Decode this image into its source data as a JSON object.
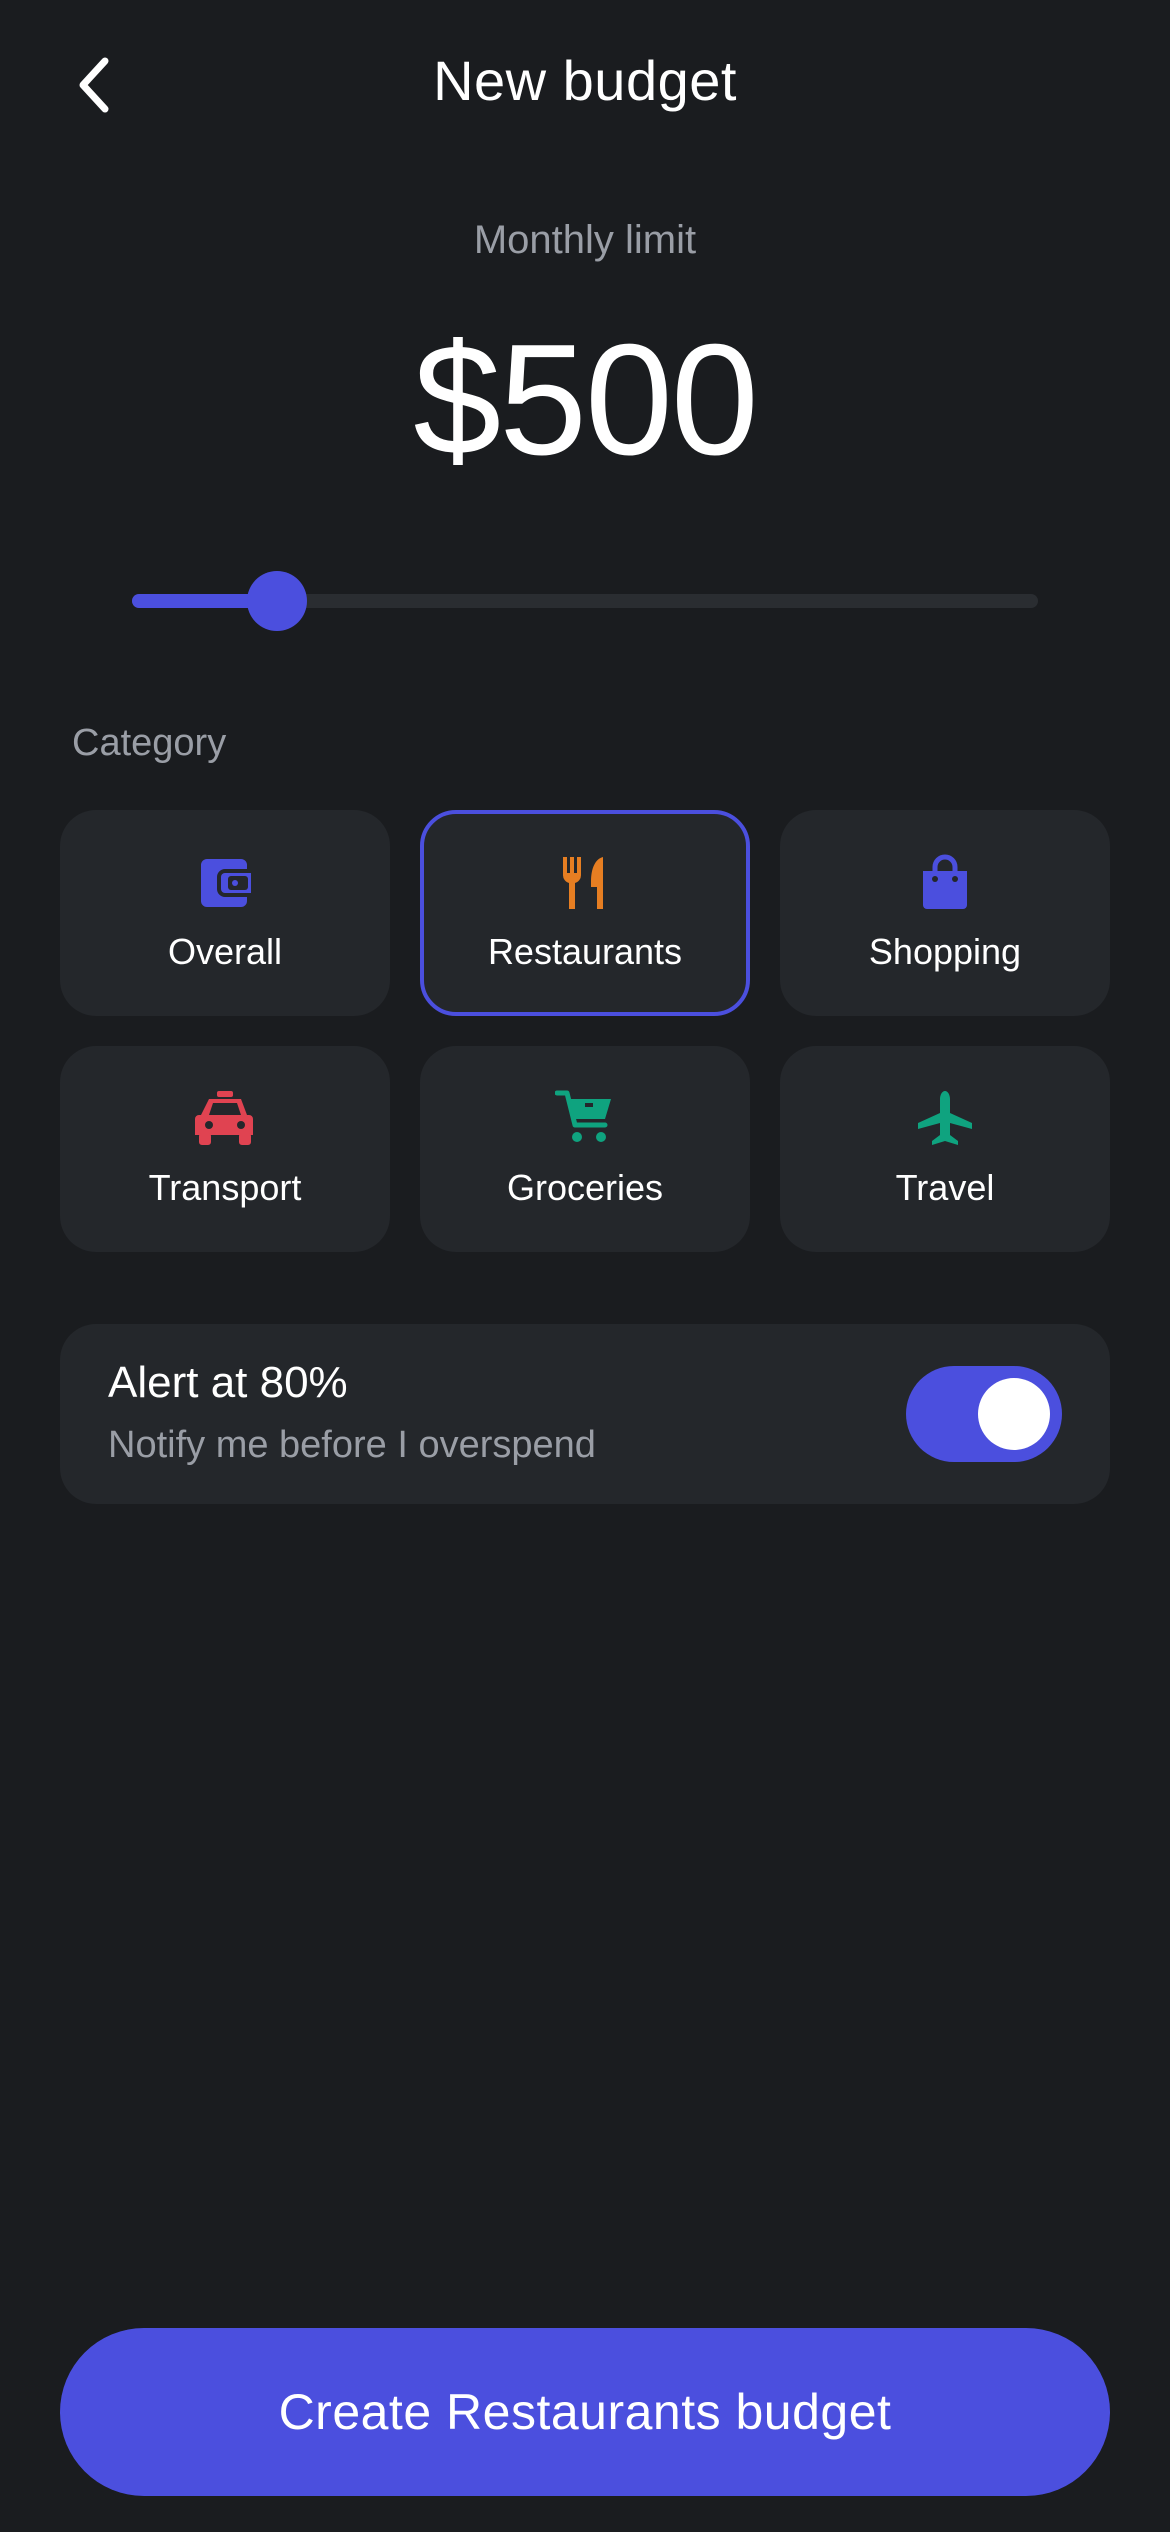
{
  "header": {
    "title": "New budget",
    "back_icon": "chevron-left-icon"
  },
  "limit": {
    "label": "Monthly limit",
    "amount": "$500",
    "slider_fraction": 0.16
  },
  "category": {
    "label": "Category",
    "selected": "Restaurants",
    "items": [
      {
        "label": "Overall",
        "icon": "wallet-icon",
        "color": "#4b4fde"
      },
      {
        "label": "Restaurants",
        "icon": "utensils-icon",
        "color": "#e67e22"
      },
      {
        "label": "Shopping",
        "icon": "shopping-bag-icon",
        "color": "#4b4fde"
      },
      {
        "label": "Transport",
        "icon": "taxi-icon",
        "color": "#e04351"
      },
      {
        "label": "Groceries",
        "icon": "cart-icon",
        "color": "#0fa37f"
      },
      {
        "label": "Travel",
        "icon": "airplane-icon",
        "color": "#0fa37f"
      }
    ]
  },
  "alert": {
    "title": "Alert at 80%",
    "subtitle": "Notify me before I overspend",
    "enabled": true
  },
  "cta": {
    "label": "Create Restaurants budget"
  },
  "colors": {
    "background": "#1a1c1f",
    "card": "#24272b",
    "accent": "#4b4fde",
    "muted_text": "#9a9ea6"
  }
}
